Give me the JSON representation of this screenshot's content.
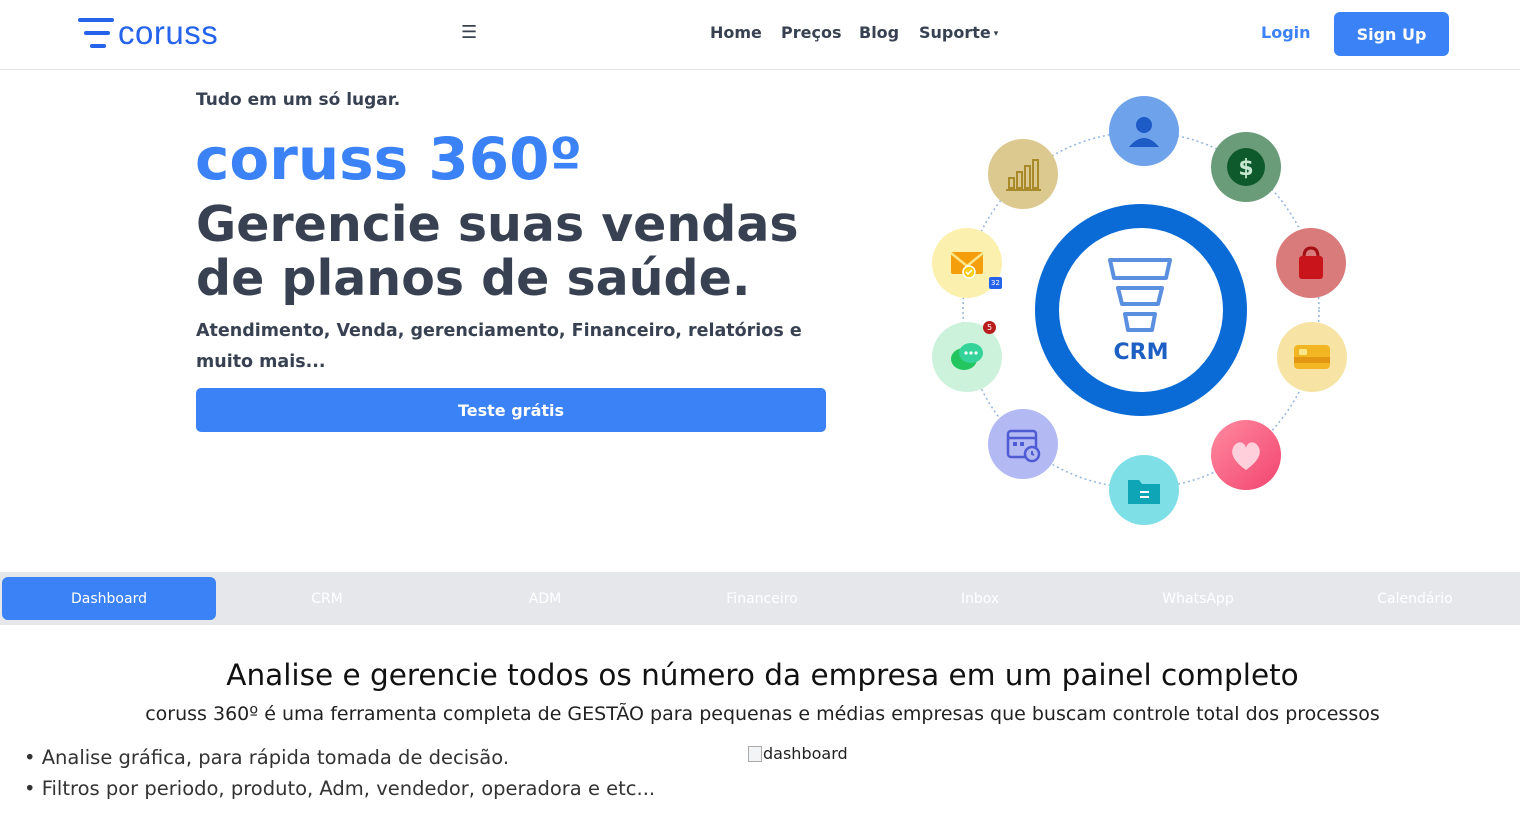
{
  "nav": {
    "logo_text": "coruss",
    "menu_icon": "hamburger-icon",
    "items": [
      {
        "label": "Home"
      },
      {
        "label": "Preços"
      },
      {
        "label": "Blog"
      },
      {
        "label": "Suporte"
      }
    ],
    "login_label": "Login",
    "signup_label": "Sign Up"
  },
  "hero": {
    "eyebrow": "Tudo em um só lugar.",
    "brand_title": "coruss 360º",
    "headline": "Gerencie suas vendas de planos de saúde.",
    "subtext": "Atendimento, Venda, gerenciamento, Financeiro, relatórios e muito mais...",
    "cta_label": "Teste grátis"
  },
  "illustration": {
    "center_label": "CRM",
    "mail_badge": "32",
    "chat_badge": "5",
    "icons": [
      "user-icon",
      "dollar-icon",
      "shopping-bag-icon",
      "credit-card-icon",
      "heart-icon",
      "folder-icon",
      "calendar-icon",
      "chat-icon",
      "mail-icon",
      "bar-chart-icon"
    ]
  },
  "tabs": [
    {
      "label": "Dashboard",
      "active": true
    },
    {
      "label": "CRM"
    },
    {
      "label": "ADM"
    },
    {
      "label": "Financeiro"
    },
    {
      "label": "Inbox"
    },
    {
      "label": "WhatsApp"
    },
    {
      "label": "Calendário"
    }
  ],
  "content": {
    "title": "Analise e gerencie todos os número da empresa em um painel completo",
    "subtitle": "coruss 360º é uma ferramenta completa de GESTÃO para pequenas e médias empresas que buscam controle total dos processos",
    "bullets": [
      "• Analise gráfica, para rápida tomada de decisão.",
      "• Filtros por periodo, produto, Adm, vendedor, operadora e etc..."
    ],
    "image_alt": "dashboard"
  },
  "colors": {
    "accent": "#3b82f6",
    "text": "#374151",
    "tab_bar": "#e5e7eb",
    "crm_ring": "#0b6bd6"
  }
}
